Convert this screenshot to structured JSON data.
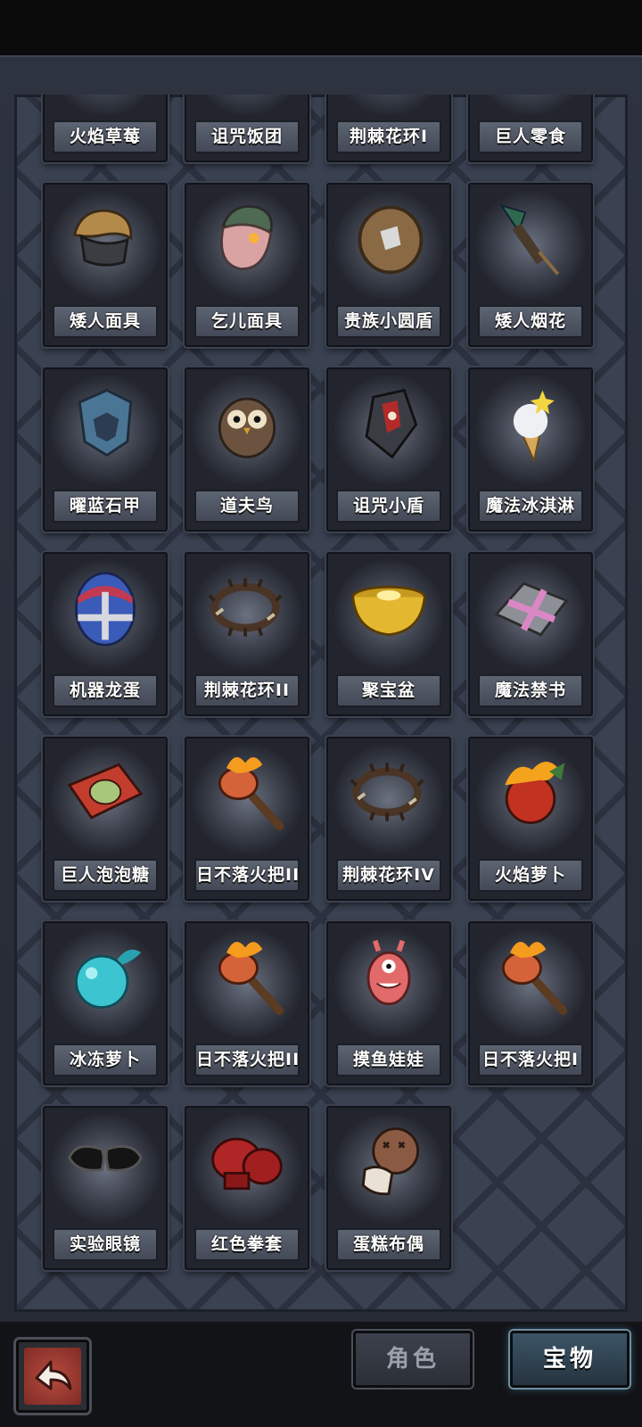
{
  "items": [
    {
      "label": "火焰草莓",
      "icon": "fire-strawberry-icon"
    },
    {
      "label": "诅咒饭团",
      "icon": "cursed-rice-ball-icon"
    },
    {
      "label": "荆棘花环I",
      "icon": "thorn-wreath-icon"
    },
    {
      "label": "巨人零食",
      "icon": "giant-snack-icon"
    },
    {
      "label": "矮人面具",
      "icon": "dwarf-mask-icon"
    },
    {
      "label": "乞儿面具",
      "icon": "beggar-mask-icon"
    },
    {
      "label": "贵族小圆盾",
      "icon": "noble-buckler-icon"
    },
    {
      "label": "矮人烟花",
      "icon": "dwarf-firework-icon"
    },
    {
      "label": "曜蓝石甲",
      "icon": "blue-stone-armor-icon"
    },
    {
      "label": "道夫鸟",
      "icon": "owl-bird-icon"
    },
    {
      "label": "诅咒小盾",
      "icon": "cursed-shield-icon"
    },
    {
      "label": "魔法冰淇淋",
      "icon": "magic-ice-cream-icon"
    },
    {
      "label": "机器龙蛋",
      "icon": "mech-dragon-egg-icon"
    },
    {
      "label": "荆棘花环II",
      "icon": "thorn-wreath-icon"
    },
    {
      "label": "聚宝盆",
      "icon": "treasure-bowl-icon"
    },
    {
      "label": "魔法禁书",
      "icon": "forbidden-book-icon"
    },
    {
      "label": "巨人泡泡糖",
      "icon": "giant-bubblegum-icon"
    },
    {
      "label": "日不落火把II",
      "icon": "torch-icon"
    },
    {
      "label": "荆棘花环IV",
      "icon": "thorn-wreath-icon"
    },
    {
      "label": "火焰萝卜",
      "icon": "fire-radish-icon"
    },
    {
      "label": "冰冻萝卜",
      "icon": "frozen-radish-icon"
    },
    {
      "label": "日不落火把II",
      "icon": "torch-icon"
    },
    {
      "label": "摸鱼娃娃",
      "icon": "slacker-doll-icon"
    },
    {
      "label": "日不落火把I",
      "icon": "torch-icon"
    },
    {
      "label": "实验眼镜",
      "icon": "lab-goggles-icon"
    },
    {
      "label": "红色拳套",
      "icon": "boxing-glove-icon"
    },
    {
      "label": "蛋糕布偶",
      "icon": "cake-doll-icon"
    }
  ],
  "tabs": {
    "role": "角色",
    "treasure": "宝物"
  },
  "back_icon": "back-arrow-icon"
}
